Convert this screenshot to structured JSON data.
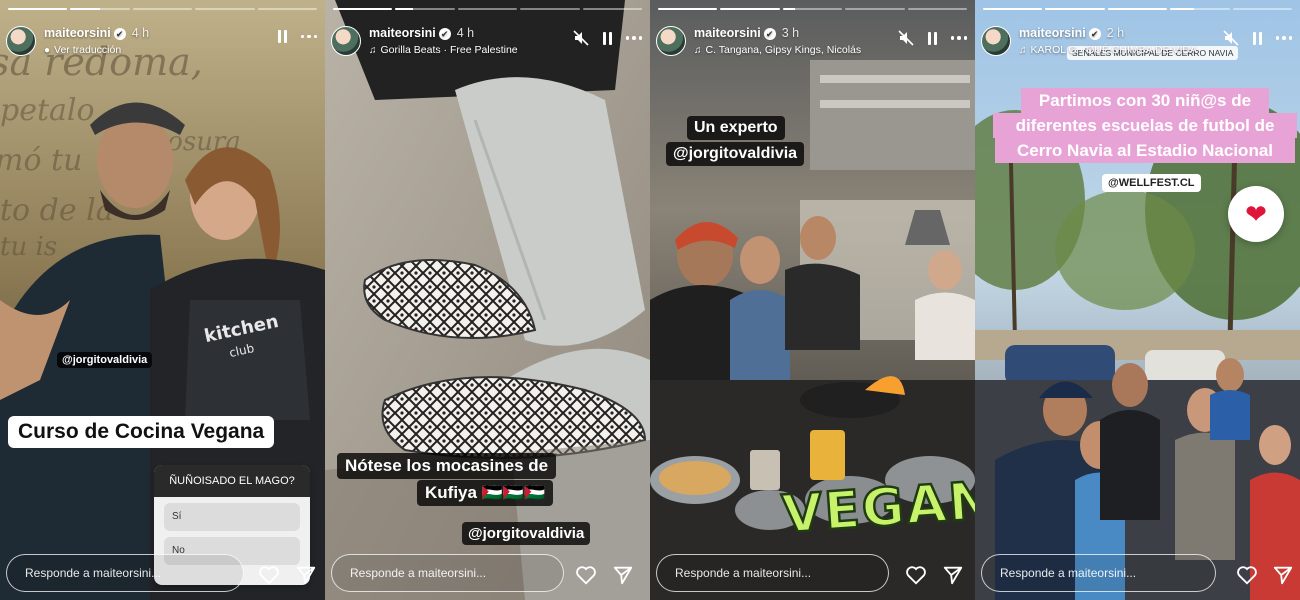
{
  "reply_placeholder": "Responde a maiteorsini...",
  "colors": {
    "pink_banner": "#e8a3d6",
    "vegan_sticker": "#c7f26a",
    "heart": "#e0153b"
  },
  "stories": [
    {
      "username": "maiteorsini",
      "time_ago": "4 h",
      "subline": "Ver traducción",
      "subline_icon": "translate-icon",
      "muted": false,
      "progress": [
        1,
        0.5,
        0,
        0,
        0
      ],
      "mention": "@jorgitovaldivia",
      "caption": "Curso de Cocina Vegana",
      "poll": {
        "question": "ÑUÑOISADO EL MAGO?",
        "options": [
          "Sí",
          "No"
        ]
      },
      "apron_text": "kitchen club"
    },
    {
      "username": "maiteorsini",
      "time_ago": "4 h",
      "subline": "Gorilla Beats · Free Palestine",
      "subline_icon": "music-icon",
      "muted": true,
      "progress": [
        1,
        0.3,
        0,
        0,
        0
      ],
      "text": "Nótese los mocasines de",
      "text2": "Kufiya 🇵🇸🇵🇸🇵🇸",
      "mention": "@jorgitovaldivia"
    },
    {
      "username": "maiteorsini",
      "time_ago": "3 h",
      "subline": "C. Tangana, Gipsy Kings, Nicolás",
      "subline_icon": "music-icon",
      "muted": true,
      "progress": [
        1,
        1,
        0.2,
        0,
        0
      ],
      "text": "Un experto",
      "mention": "@jorgitovaldivia",
      "sticker": "VEGAN"
    },
    {
      "username": "maiteorsini",
      "time_ago": "2 h",
      "subline": "KAROL G · QUÉ CHIMBA DE VIDA",
      "subline_icon": "music-icon",
      "muted": true,
      "progress": [
        1,
        1,
        1,
        0.4,
        0
      ],
      "location": "SEÑALES MUNICIPAL DE CERRO NAVIA",
      "banner_lines": [
        "Partimos con 30 niñ@s de",
        "diferentes escuelas de futbol de",
        "Cerro Navia al Estadio Nacional"
      ],
      "mention": "@WELLFEST.CL",
      "reaction": "heart-reaction"
    }
  ]
}
